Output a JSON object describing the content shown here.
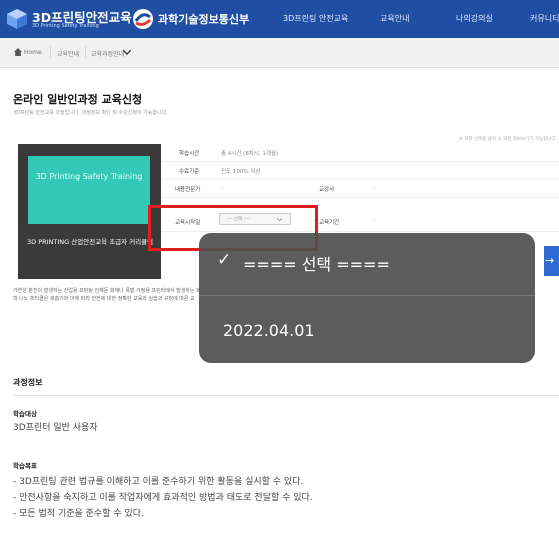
{
  "header": {
    "logo_title": "3D프린팅안전교육",
    "logo_sub": "3D Printing Safety Training",
    "ministry": "과학기술정보통신부",
    "nav": [
      "3D프린팅 안전교육",
      "교육안내",
      "나의강의실",
      "커뮤니티"
    ],
    "brand_color": "#1f4ea3"
  },
  "breadcrumb": {
    "home": "Home",
    "level1": "교육안내",
    "level2": "교육과정안내"
  },
  "page": {
    "title": "온라인 일반인과정 교육신청",
    "description": "3D프린팅 안전교육 과정입니다. 과정정보 확인 및 수강신청이 가능합니다."
  },
  "notice": "※ 과정 선택을 클릭 시 과정 정보보기가 가능합니다.",
  "course": {
    "thumb_text": "3D Printing Safety Training",
    "title": "3D PRINTING 산업안전교육 초급자 커리큘럼",
    "thumb_color": "#34c9b6"
  },
  "info": {
    "study_time_label": "학습시간",
    "study_time_value": "총 4시간 (8차시, 1개월)",
    "completion_label": "수료기준",
    "completion_value": "진도 100% 이상",
    "expert_label": "내용전문가",
    "expert_value": "-",
    "instructor_label": "교강사",
    "instructor_value": "-",
    "start_label": "교육시작일",
    "start_select_placeholder": "---- 선택 ----",
    "period_label": "교육기간",
    "period_value": "-"
  },
  "dropdown": {
    "options": [
      {
        "label": "==== 선택 ====",
        "selected": true
      },
      {
        "label": "2022.04.01",
        "selected": false
      }
    ]
  },
  "description_text": "가연성 분진이 발생하는 산업용 프린팅 언제든 화재나 폭발 가정용 프린터에서 발생하는 화학 나노 파티클은 호흡기와 이에 따라 안전에 대한 정확한 교육과 실습과 규정에 따른 교",
  "course_info": {
    "section_title": "과정정보",
    "target_label": "학습대상",
    "target_value": "3D프린터 일반 사용자",
    "goal_label": "학습목표",
    "goals": [
      "- 3D프린팅 관련 법규를 이해하고 이를 준수하기 위한 활동을 실시할 수 있다.",
      "- 안전사항을 숙지하고 이를 작업자에게 효과적인 방법과 태도로 전달할 수 있다.",
      "- 모든 법적 기준을 준수할 수 있다."
    ]
  }
}
